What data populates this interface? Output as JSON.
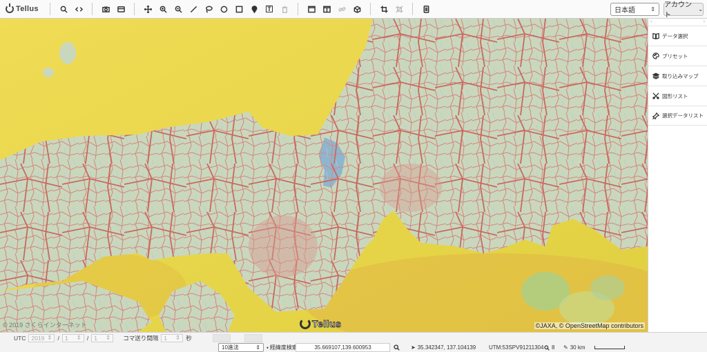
{
  "app": {
    "logo_text": "Tellus"
  },
  "toolbar": {
    "groups": [
      [
        {
          "name": "search-icon"
        },
        {
          "name": "share-code-icon"
        }
      ],
      [
        {
          "name": "camera-icon"
        },
        {
          "name": "card-icon"
        }
      ],
      [
        {
          "name": "pan-icon"
        },
        {
          "name": "zoom-in-icon"
        },
        {
          "name": "zoom-out-icon"
        },
        {
          "name": "draw-line-icon"
        },
        {
          "name": "lasso-icon"
        },
        {
          "name": "draw-circle-icon"
        },
        {
          "name": "draw-rectangle-icon"
        },
        {
          "name": "pin-icon"
        },
        {
          "name": "text-tool-icon"
        },
        {
          "name": "trash-icon",
          "disabled": true
        }
      ],
      [
        {
          "name": "single-view-icon"
        },
        {
          "name": "split-view-icon"
        },
        {
          "name": "link-icon",
          "disabled": true
        },
        {
          "name": "cube-icon"
        }
      ],
      [
        {
          "name": "crop-icon"
        },
        {
          "name": "crop-disabled-icon",
          "disabled": true
        }
      ],
      [
        {
          "name": "document-icon"
        }
      ]
    ],
    "language": "日本語",
    "account_label": "アカウント",
    "chevron": "⌄"
  },
  "side_panel": {
    "collapse_left": "‹",
    "collapse_right": "›",
    "items": [
      {
        "icon": "book-icon",
        "label": "データ選択"
      },
      {
        "icon": "palette-icon",
        "label": "プリセット"
      },
      {
        "icon": "layers-icon",
        "label": "取り込みマップ"
      },
      {
        "icon": "shapes-icon",
        "label": "図形リスト"
      },
      {
        "icon": "pin-list-icon",
        "label": "選択データリスト"
      }
    ]
  },
  "map": {
    "attribution": "©JAXA, © OpenStreetMap contributors",
    "copyright": "© 2019 さくらインターネット",
    "watermark": "Tellus"
  },
  "timebar": {
    "utc_label": "UTC",
    "year": "2019",
    "month": "1",
    "day": "1",
    "slash": "/",
    "interval_label": "コマ送り間隔",
    "interval_value": "1",
    "seconds_label": "秒"
  },
  "statusbar": {
    "notation": "10進法",
    "latlon_label": "経緯度検索",
    "coordinate": "35.669107,139.600953",
    "cursor_coords": "35.342347, 137.104139",
    "utm": "UTM:53SPV91211304",
    "zoom": "8",
    "scale": "30 km"
  }
}
